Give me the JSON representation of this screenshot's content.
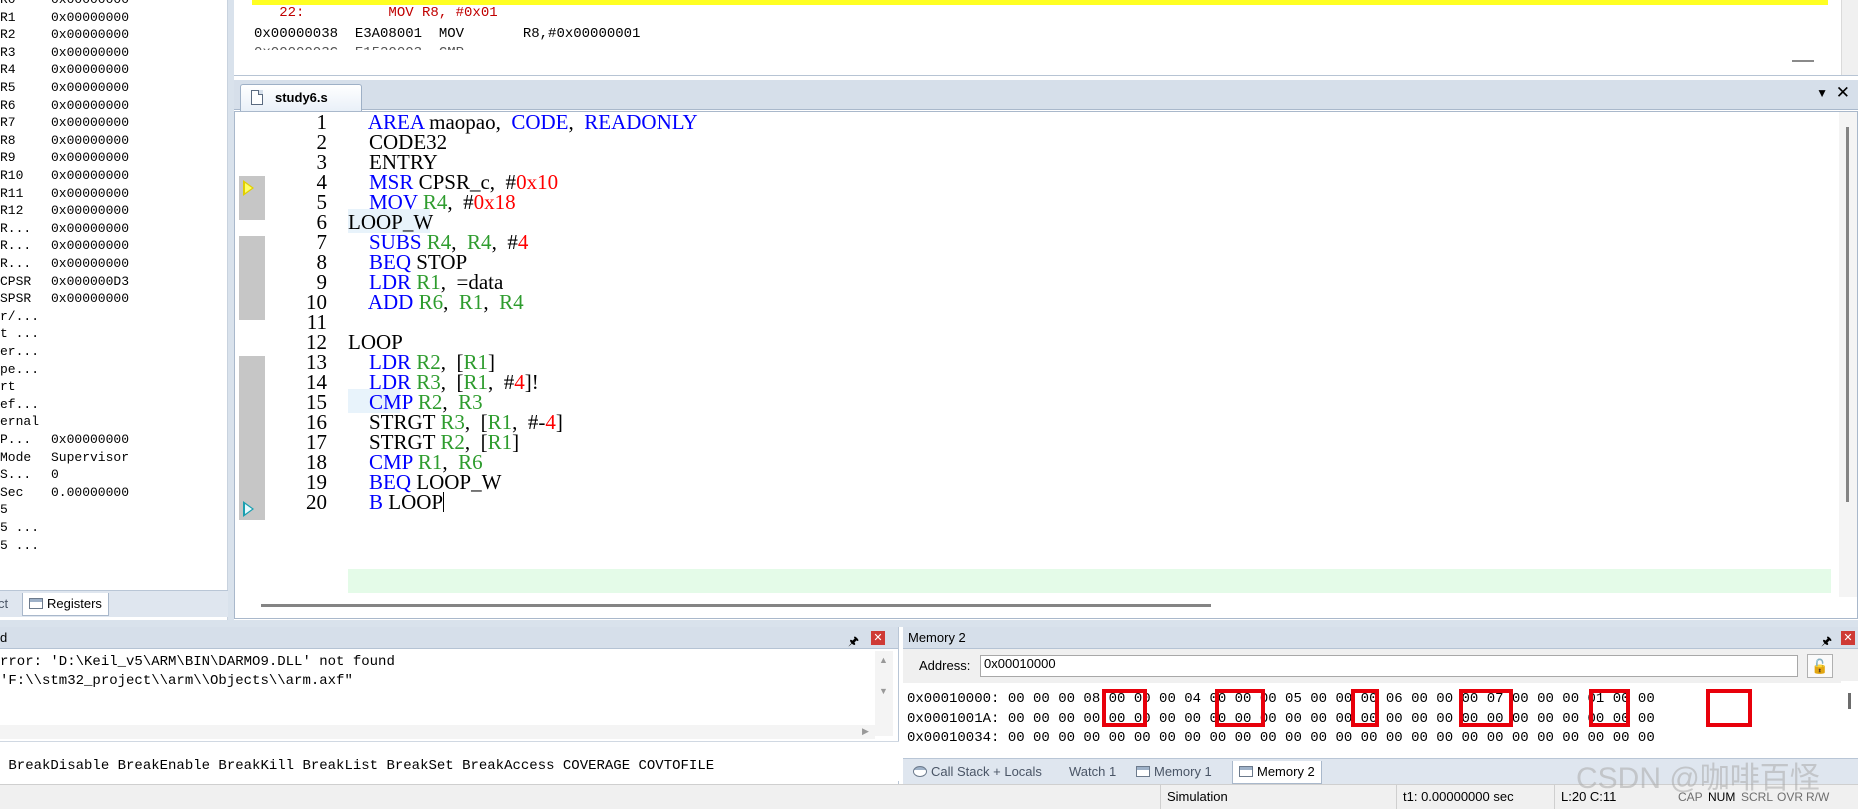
{
  "registers": [
    {
      "name": "R0",
      "value": "0x00000000"
    },
    {
      "name": "R1",
      "value": "0x00000000"
    },
    {
      "name": "R2",
      "value": "0x00000000"
    },
    {
      "name": "R3",
      "value": "0x00000000"
    },
    {
      "name": "R4",
      "value": "0x00000000"
    },
    {
      "name": "R5",
      "value": "0x00000000"
    },
    {
      "name": "R6",
      "value": "0x00000000"
    },
    {
      "name": "R7",
      "value": "0x00000000"
    },
    {
      "name": "R8",
      "value": "0x00000000"
    },
    {
      "name": "R9",
      "value": "0x00000000"
    },
    {
      "name": "R10",
      "value": "0x00000000"
    },
    {
      "name": "R11",
      "value": "0x00000000"
    },
    {
      "name": "R12",
      "value": "0x00000000"
    },
    {
      "name": "R...",
      "value": "0x00000000"
    },
    {
      "name": "R...",
      "value": "0x00000000"
    },
    {
      "name": "R...",
      "value": "0x00000000"
    },
    {
      "name": "CPSR",
      "value": "0x000000D3"
    },
    {
      "name": "SPSR",
      "value": "0x00000000"
    },
    {
      "name": "r/...",
      "value": ""
    },
    {
      "name": "t ...",
      "value": ""
    },
    {
      "name": "er...",
      "value": ""
    },
    {
      "name": "pe...",
      "value": ""
    },
    {
      "name": "rt",
      "value": ""
    },
    {
      "name": "ef...",
      "value": ""
    },
    {
      "name": "ernal",
      "value": ""
    },
    {
      "name": "P...",
      "value": "0x00000000"
    },
    {
      "name": "Mode",
      "value": "Supervisor"
    },
    {
      "name": "S...",
      "value": "0"
    },
    {
      "name": "Sec",
      "value": "0.00000000"
    },
    {
      "name": "5",
      "value": ""
    },
    {
      "name": "5 ...",
      "value": ""
    },
    {
      "name": "5 ...",
      "value": ""
    }
  ],
  "register_tabs": {
    "project": "ct",
    "registers": "Registers"
  },
  "disassembly": {
    "line_source": "   22:          MOV R8, #0x01",
    "line_instr": "0x00000038  E3A08001  MOV       R8,#0x00000001"
  },
  "editor": {
    "tab_label": "study6.s",
    "menu_glyph": "▼",
    "close_glyph": "✕",
    "lines": [
      {
        "n": "1",
        "segs": [
          {
            "t": "    ",
            "c": ""
          },
          {
            "t": "AREA",
            "c": "kw"
          },
          {
            "t": " maopao,  ",
            "c": ""
          },
          {
            "t": "CODE",
            "c": "kw"
          },
          {
            "t": ",  ",
            "c": ""
          },
          {
            "t": "READONLY",
            "c": "kw"
          }
        ]
      },
      {
        "n": "2",
        "segs": [
          {
            "t": "    CODE32",
            "c": ""
          }
        ]
      },
      {
        "n": "3",
        "segs": [
          {
            "t": "    ENTRY",
            "c": ""
          }
        ]
      },
      {
        "n": "4",
        "segs": [
          {
            "t": "    ",
            "c": ""
          },
          {
            "t": "MSR",
            "c": "kw"
          },
          {
            "t": " CPSR_c,  #",
            "c": ""
          },
          {
            "t": "0x10",
            "c": "nm"
          }
        ]
      },
      {
        "n": "5",
        "segs": [
          {
            "t": "    ",
            "c": ""
          },
          {
            "t": "MOV",
            "c": "kw"
          },
          {
            "t": " ",
            "c": ""
          },
          {
            "t": "R4",
            "c": "rg"
          },
          {
            "t": ",  #",
            "c": ""
          },
          {
            "t": "0x18",
            "c": "nm"
          }
        ]
      },
      {
        "n": "6",
        "segs": [
          {
            "t": "LOOP_W",
            "c": ""
          }
        ]
      },
      {
        "n": "7",
        "segs": [
          {
            "t": "    ",
            "c": ""
          },
          {
            "t": "SUBS",
            "c": "kw"
          },
          {
            "t": " ",
            "c": ""
          },
          {
            "t": "R4",
            "c": "rg"
          },
          {
            "t": ",  ",
            "c": ""
          },
          {
            "t": "R4",
            "c": "rg"
          },
          {
            "t": ",  #",
            "c": ""
          },
          {
            "t": "4",
            "c": "nm"
          }
        ]
      },
      {
        "n": "8",
        "segs": [
          {
            "t": "    ",
            "c": ""
          },
          {
            "t": "BEQ",
            "c": "kw"
          },
          {
            "t": " STOP",
            "c": ""
          }
        ]
      },
      {
        "n": "9",
        "segs": [
          {
            "t": "    ",
            "c": ""
          },
          {
            "t": "LDR",
            "c": "kw"
          },
          {
            "t": " ",
            "c": ""
          },
          {
            "t": "R1",
            "c": "rg"
          },
          {
            "t": ",  =data",
            "c": ""
          }
        ]
      },
      {
        "n": "10",
        "segs": [
          {
            "t": "    ",
            "c": ""
          },
          {
            "t": "ADD",
            "c": "kw"
          },
          {
            "t": " ",
            "c": ""
          },
          {
            "t": "R6",
            "c": "rg"
          },
          {
            "t": ",  ",
            "c": ""
          },
          {
            "t": "R1",
            "c": "rg"
          },
          {
            "t": ",  ",
            "c": ""
          },
          {
            "t": "R4",
            "c": "rg"
          }
        ]
      },
      {
        "n": "11",
        "segs": []
      },
      {
        "n": "12",
        "segs": [
          {
            "t": "LOOP",
            "c": ""
          }
        ]
      },
      {
        "n": "13",
        "segs": [
          {
            "t": "    ",
            "c": ""
          },
          {
            "t": "LDR",
            "c": "kw"
          },
          {
            "t": " ",
            "c": ""
          },
          {
            "t": "R2",
            "c": "rg"
          },
          {
            "t": ",  [",
            "c": ""
          },
          {
            "t": "R1",
            "c": "rg"
          },
          {
            "t": "]",
            "c": ""
          }
        ]
      },
      {
        "n": "14",
        "segs": [
          {
            "t": "    ",
            "c": ""
          },
          {
            "t": "LDR",
            "c": "kw"
          },
          {
            "t": " ",
            "c": ""
          },
          {
            "t": "R3",
            "c": "rg"
          },
          {
            "t": ",  [",
            "c": ""
          },
          {
            "t": "R1",
            "c": "rg"
          },
          {
            "t": ",  #",
            "c": ""
          },
          {
            "t": "4",
            "c": "nm"
          },
          {
            "t": "]!",
            "c": ""
          }
        ]
      },
      {
        "n": "15",
        "segs": [
          {
            "t": "    ",
            "c": ""
          },
          {
            "t": "CMP",
            "c": "kw"
          },
          {
            "t": " ",
            "c": ""
          },
          {
            "t": "R2",
            "c": "rg"
          },
          {
            "t": ",  ",
            "c": ""
          },
          {
            "t": "R3",
            "c": "rg"
          }
        ]
      },
      {
        "n": "16",
        "segs": [
          {
            "t": "    STRGT ",
            "c": ""
          },
          {
            "t": "R3",
            "c": "rg"
          },
          {
            "t": ",  [",
            "c": ""
          },
          {
            "t": "R1",
            "c": "rg"
          },
          {
            "t": ",  #-",
            "c": ""
          },
          {
            "t": "4",
            "c": "nm"
          },
          {
            "t": "]",
            "c": ""
          }
        ]
      },
      {
        "n": "17",
        "segs": [
          {
            "t": "    STRGT ",
            "c": ""
          },
          {
            "t": "R2",
            "c": "rg"
          },
          {
            "t": ",  [",
            "c": ""
          },
          {
            "t": "R1",
            "c": "rg"
          },
          {
            "t": "]",
            "c": ""
          }
        ]
      },
      {
        "n": "18",
        "segs": [
          {
            "t": "    ",
            "c": ""
          },
          {
            "t": "CMP",
            "c": "kw"
          },
          {
            "t": " ",
            "c": ""
          },
          {
            "t": "R1",
            "c": "rg"
          },
          {
            "t": ",  ",
            "c": ""
          },
          {
            "t": "R6",
            "c": "rg"
          }
        ]
      },
      {
        "n": "19",
        "segs": [
          {
            "t": "    ",
            "c": ""
          },
          {
            "t": "BEQ",
            "c": "kw"
          },
          {
            "t": " LOOP_W",
            "c": ""
          }
        ]
      },
      {
        "n": "20",
        "segs": [
          {
            "t": "    ",
            "c": ""
          },
          {
            "t": "B",
            "c": "kw"
          },
          {
            "t": " LOOP",
            "c": ""
          }
        ]
      }
    ]
  },
  "command": {
    "title": "d",
    "lines": [
      "rror: 'D:\\Keil_v5\\ARM\\BIN\\DARMO9.DLL' not found",
      "'F:\\\\stm32_project\\\\arm\\\\Objects\\\\arm.axf\""
    ],
    "help": " BreakDisable BreakEnable BreakKill BreakList BreakSet BreakAccess COVERAGE COVTOFILE",
    "pin": "🖈",
    "close": "✕"
  },
  "memory": {
    "title": "Memory 2",
    "address_label": "Address:",
    "address_value": "0x00010000",
    "rows": [
      "0x00010000: 00 00 00 08 00 00 00 04 00 00 00 05 00 00 00 06 00 00 00 07 00 00 00 01 00 00",
      "0x0001001A: 00 00 00 00 00 00 00 00 00 00 00 00 00 00 00 00 00 00 00 00 00 00 00 00 00 00",
      "0x00010034: 00 00 00 00 00 00 00 00 00 00 00 00 00 00 00 00 00 00 00 00 00 00 00 00 00 00"
    ],
    "highlighted_bytes": [
      "08",
      "04",
      "05",
      "06",
      "07",
      "01"
    ],
    "tabs": [
      "Call Stack + Locals",
      "Watch 1",
      "Memory 1",
      "Memory 2"
    ],
    "pin": "🖈",
    "close": "✕"
  },
  "status": {
    "mode": "Simulation",
    "time": "t1: 0.00000000 sec",
    "position": "L:20 C:11",
    "indicators": [
      "CAP",
      "NUM",
      "SCRL",
      "OVR",
      "R/W"
    ],
    "active_indicator": "NUM"
  },
  "watermark": "CSDN @咖啡百怪",
  "colors": {
    "keyword": "#0000ff",
    "register": "#2e9c2e",
    "number": "#ff0000",
    "current_line": "#e4fbe8",
    "highlight_box": "#e8000b",
    "disasm_highlight": "#ffff22"
  }
}
